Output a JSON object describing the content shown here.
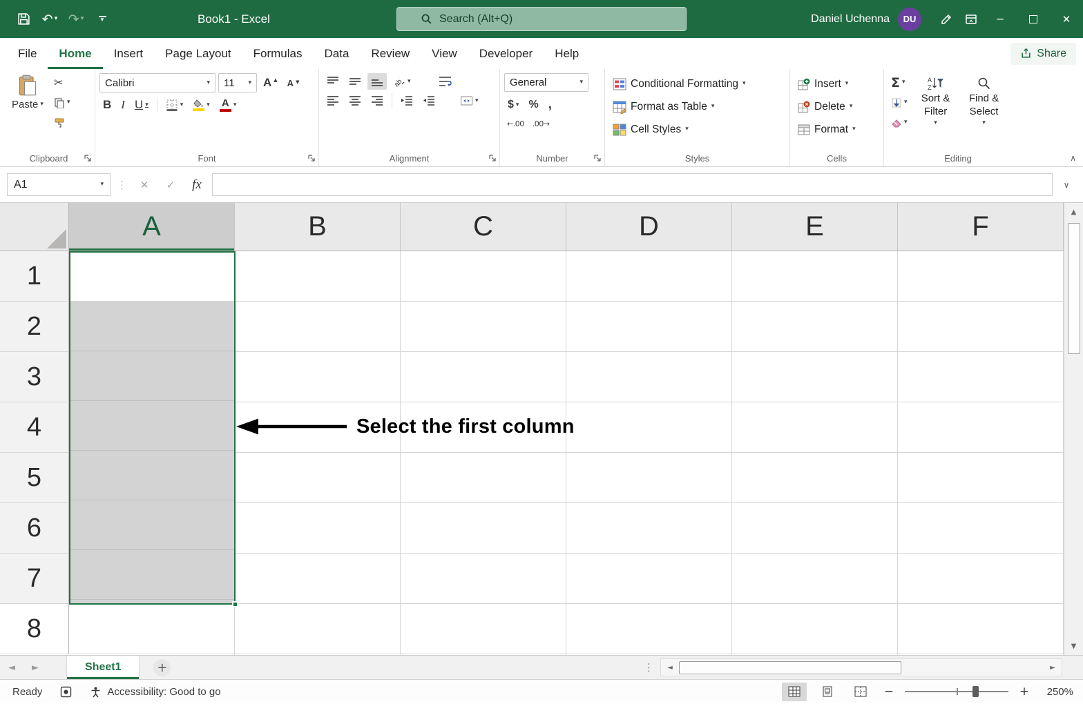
{
  "colors": {
    "excel_green": "#217346",
    "titlebar_green": "#1e6b41",
    "search_green": "#8fb9a3",
    "avatar_purple": "#6b3fa0",
    "selection_fill": "#d3d3d3",
    "header_selected": "#cdcdcd",
    "fill_color_swatch": "#ffd400",
    "font_color_swatch": "#c00000"
  },
  "icons": {
    "dropdown_chevron": "▾",
    "collapse_ribbon": "∧",
    "expand_formula_bar": "∨",
    "undo": "↶",
    "redo": "↷",
    "scissors": "✂",
    "cancel": "✕",
    "enter": "✓",
    "minimize": "─",
    "close": "✕",
    "small_up": "▲",
    "small_down": "▼",
    "scroll_up": "▲",
    "scroll_down": "▼",
    "scroll_left": "◄",
    "scroll_right": "►",
    "nav_left": "◄",
    "nav_right": "►",
    "drag_dots": "⋮",
    "plus": "+",
    "minus": "−"
  },
  "titlebar": {
    "title": "Book1 - Excel",
    "search_placeholder": "Search (Alt+Q)",
    "user_name": "Daniel Uchenna",
    "avatar_initials": "DU"
  },
  "tabs": {
    "items": [
      "File",
      "Home",
      "Insert",
      "Page Layout",
      "Formulas",
      "Data",
      "Review",
      "View",
      "Developer",
      "Help"
    ],
    "active": "Home",
    "share_label": "Share"
  },
  "ribbon": {
    "clipboard": {
      "group_label": "Clipboard",
      "paste_label": "Paste"
    },
    "font": {
      "group_label": "Font",
      "font_name": "Calibri",
      "font_size": "11",
      "bold": "B",
      "italic": "I",
      "underline": "U",
      "grow_letter": "A",
      "shrink_letter": "A",
      "font_color_letter": "A"
    },
    "alignment": {
      "group_label": "Alignment"
    },
    "number": {
      "group_label": "Number",
      "format_value": "General",
      "currency": "$",
      "percent": "%",
      "comma": ",",
      "increase_decimal": "←.00",
      "decrease_decimal": ".00→"
    },
    "styles": {
      "group_label": "Styles",
      "conditional_formatting": "Conditional Formatting",
      "format_as_table": "Format as Table",
      "cell_styles": "Cell Styles"
    },
    "cells": {
      "group_label": "Cells",
      "insert_label": "Insert",
      "delete_label": "Delete",
      "format_label": "Format"
    },
    "editing": {
      "group_label": "Editing",
      "autosum": "Σ",
      "sort_filter": "Sort & Filter",
      "find_select": "Find & Select"
    }
  },
  "formula_bar": {
    "name_box_value": "A1",
    "fx_label": "fx"
  },
  "grid": {
    "columns": [
      "A",
      "B",
      "C",
      "D",
      "E",
      "F"
    ],
    "rows": [
      "1",
      "2",
      "3",
      "4",
      "5",
      "6",
      "7",
      "8"
    ],
    "selected_column": "A",
    "selected_range": "A1:A7"
  },
  "annotation": {
    "text": "Select the first column"
  },
  "sheet_bar": {
    "active_sheet": "Sheet1"
  },
  "status_bar": {
    "mode": "Ready",
    "accessibility": "Accessibility: Good to go",
    "zoom_level": "250%"
  }
}
